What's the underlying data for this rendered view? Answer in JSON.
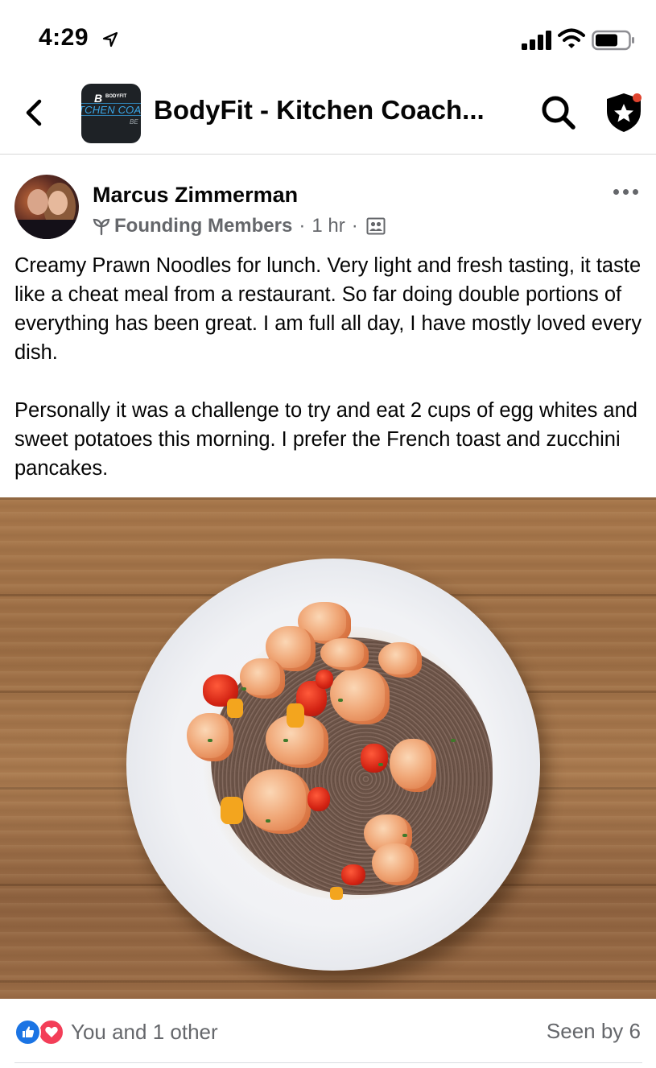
{
  "status_bar": {
    "time": "4:29",
    "icons": [
      "location-arrow-icon",
      "cellular-signal-icon",
      "wifi-icon",
      "battery-icon"
    ]
  },
  "header": {
    "title": "BodyFit - Kitchen Coach...",
    "back_icon": "chevron-left-icon",
    "search_icon": "search-icon",
    "admin_icon": "shield-star-icon",
    "notification_dot_color": "#e0442f",
    "group_avatar": {
      "brand": "B",
      "brand_small": "BODYFIT",
      "line": "TCHEN COAC",
      "tail": "BE"
    }
  },
  "post": {
    "author": "Marcus Zimmerman",
    "badge_icon": "sprout-icon",
    "badge": "Founding Members",
    "separator": "·",
    "time": "1 hr",
    "audience_icon": "members-group-icon",
    "paragraphs": [
      "Creamy Prawn Noodles for lunch. Very light and fresh tasting, it taste like a cheat meal from a restaurant. So far doing double portions of everything has been great. I am full all day, I have mostly loved every dish.",
      "Personally it was a challenge to try and eat 2 cups of egg whites and sweet potatoes this morning. I prefer the French toast and zucchini pancakes."
    ],
    "photo_subject": "plate-of-prawn-noodles"
  },
  "footer": {
    "reactions": [
      "like-icon",
      "love-icon"
    ],
    "reaction_text": "You and 1 other",
    "seen_by": "Seen by 6"
  },
  "colors": {
    "like": "#1b74e4",
    "love": "#f33e58",
    "secondary_text": "#65676b"
  }
}
